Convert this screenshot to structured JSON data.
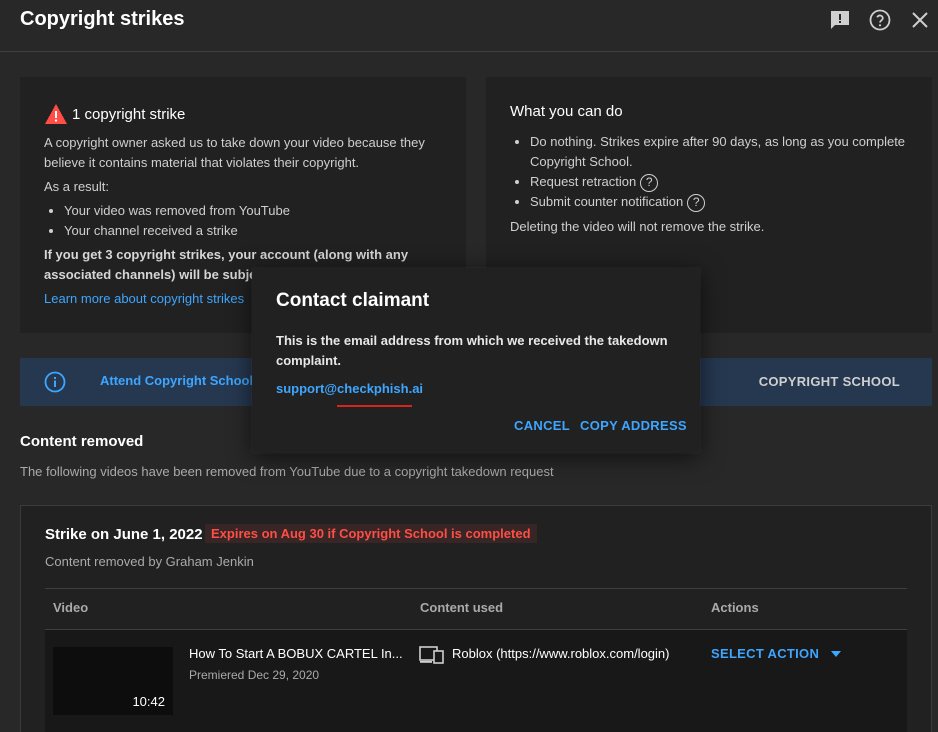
{
  "header": {
    "title": "Copyright strikes",
    "icons": [
      "feedback-icon",
      "help-icon",
      "close-icon"
    ]
  },
  "strike_card": {
    "title": "1 copyright strike",
    "description": "A copyright owner asked us to take down your video because they believe it contains material that violates their copyright.",
    "result_label": "As a result:",
    "results": [
      "Your video was removed from YouTube",
      "Your channel received a strike"
    ],
    "warning": "If you get 3 copyright strikes, your account (along with any associated channels) will be subject",
    "learn_more": "Learn more about copyright strikes"
  },
  "what_you_can_do": {
    "title": "What you can do",
    "items": [
      "Do nothing. Strikes expire after 90 days, as long as you complete Copyright School.",
      "Request retraction",
      "Submit counter notification"
    ],
    "note": "Deleting the video will not remove the strike."
  },
  "banner": {
    "text": "Attend Copyright School fo",
    "button": "COPYRIGHT SCHOOL"
  },
  "content_removed": {
    "title": "Content removed",
    "subtitle": "The following videos have been removed from YouTube due to a copyright takedown request"
  },
  "strike": {
    "date_label": "Strike on June 1, 2022",
    "expires": "Expires on Aug 30 if Copyright School is completed",
    "removed_by": "Content removed by Graham Jenkin",
    "columns": [
      "Video",
      "Content used",
      "Actions"
    ],
    "row": {
      "video_title": "How To Start A BOBUX CARTEL In...",
      "premiered": "Premiered Dec 29, 2020",
      "duration": "10:42",
      "content_used": "Roblox (https://www.roblox.com/login)",
      "action": "SELECT ACTION"
    }
  },
  "dialog": {
    "title": "Contact claimant",
    "text": "This is the email address from which we received the takedown complaint.",
    "email": "support@checkphish.ai",
    "cancel": "CANCEL",
    "copy": "COPY ADDRESS"
  },
  "colors": {
    "background": "#282828",
    "card": "#212121",
    "accent": "#3ea6ff",
    "danger": "#ff4e45",
    "banner": "#263850"
  }
}
